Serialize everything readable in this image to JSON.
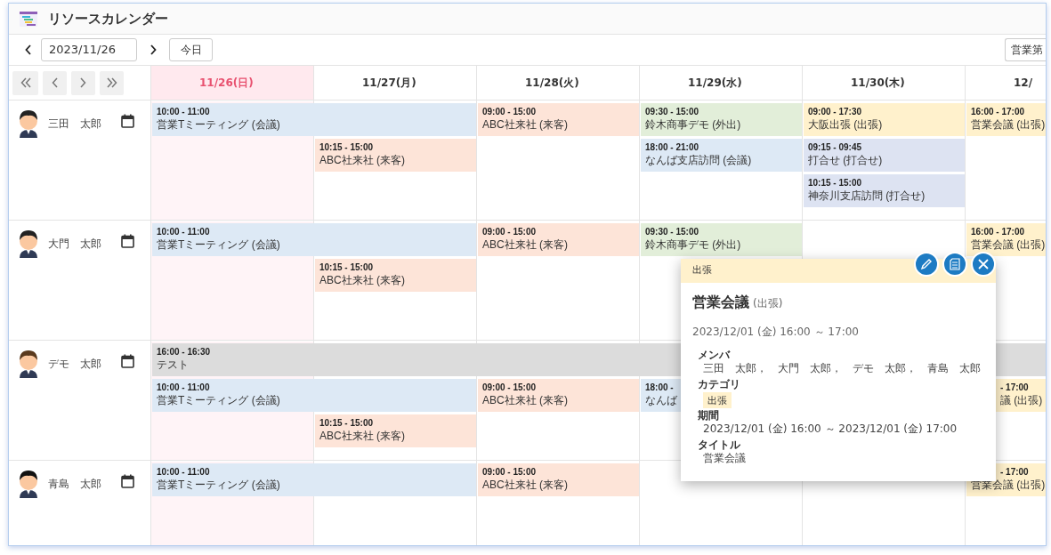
{
  "window": {
    "title": "リソースカレンダー"
  },
  "toolbar": {
    "date": "2023/11/26",
    "today_button": "今日",
    "group_select": "営業第"
  },
  "days": [
    {
      "label": "11/26(日)",
      "holiday": true
    },
    {
      "label": "11/27(月)",
      "holiday": false
    },
    {
      "label": "11/28(火)",
      "holiday": false
    },
    {
      "label": "11/29(水)",
      "holiday": false
    },
    {
      "label": "11/30(木)",
      "holiday": false
    },
    {
      "label": "12/",
      "holiday": false
    }
  ],
  "people": [
    {
      "name": "三田　太郎",
      "lanes": [
        [
          {
            "kind": "event",
            "time": "10:00 - 11:00",
            "title": "営業Tミーティング (会議)",
            "color": "#dde9f5"
          },
          {
            "kind": "continued"
          },
          {
            "kind": "event",
            "time": "09:00 - 15:00",
            "title": "ABC社来社 (来客)",
            "color": "#fde4d8"
          },
          {
            "kind": "event",
            "time": "09:30 - 15:00",
            "title": "鈴木商事デモ (外出)",
            "color": "#e2eed9"
          },
          {
            "kind": "event",
            "time": "09:00 - 17:30",
            "title": "大阪出張 (出張)",
            "color": "#fff1cc"
          },
          {
            "kind": "event",
            "time": "16:00 - 17:00",
            "title": "営業会議 (出張)",
            "color": "#fff1cc"
          }
        ],
        [
          {
            "kind": "empty"
          },
          {
            "kind": "event",
            "time": "10:15 - 15:00",
            "title": "ABC社来社 (来客)",
            "color": "#fde4d8"
          },
          {
            "kind": "empty"
          },
          {
            "kind": "event",
            "time": "18:00 - 21:00",
            "title": "なんば支店訪問 (会議)",
            "color": "#dde9f5"
          },
          {
            "kind": "event",
            "time": "09:15 - 09:45",
            "title": "打合せ (打合せ)",
            "color": "#dde3f2"
          },
          {
            "kind": "empty"
          }
        ],
        [
          {
            "kind": "empty"
          },
          {
            "kind": "empty"
          },
          {
            "kind": "empty"
          },
          {
            "kind": "empty"
          },
          {
            "kind": "event",
            "time": "10:15 - 15:00",
            "title": "神奈川支店訪問 (打合せ)",
            "color": "#dde3f2"
          },
          {
            "kind": "empty"
          }
        ]
      ]
    },
    {
      "name": "大門　太郎",
      "lanes": [
        [
          {
            "kind": "event",
            "time": "10:00 - 11:00",
            "title": "営業Tミーティング (会議)",
            "color": "#dde9f5"
          },
          {
            "kind": "continued"
          },
          {
            "kind": "event",
            "time": "09:00 - 15:00",
            "title": "ABC社来社 (来客)",
            "color": "#fde4d8"
          },
          {
            "kind": "event",
            "time": "09:30 - 15:00",
            "title": "鈴木商事デモ (外出)",
            "color": "#e2eed9"
          },
          {
            "kind": "empty"
          },
          {
            "kind": "event",
            "time": "16:00 - 17:00",
            "title": "営業会議 (出張)",
            "color": "#fff1cc"
          }
        ],
        [
          {
            "kind": "empty"
          },
          {
            "kind": "event",
            "time": "10:15 - 15:00",
            "title": "ABC社来社 (来客)",
            "color": "#fde4d8"
          },
          {
            "kind": "empty"
          },
          {
            "kind": "empty"
          },
          {
            "kind": "empty"
          },
          {
            "kind": "empty"
          }
        ]
      ]
    },
    {
      "name": "デモ　太郎",
      "lanes": [
        [
          {
            "kind": "event",
            "time": "16:00 - 16:30",
            "title": "テスト",
            "color": "#dcdcdc"
          },
          {
            "kind": "continued"
          },
          {
            "kind": "continued"
          },
          {
            "kind": "continued"
          },
          {
            "kind": "continued"
          },
          {
            "kind": "continued"
          }
        ],
        [
          {
            "kind": "event",
            "time": "10:00 - 11:00",
            "title": "営業Tミーティング (会議)",
            "color": "#dde9f5"
          },
          {
            "kind": "continued"
          },
          {
            "kind": "event",
            "time": "09:00 - 15:00",
            "title": "ABC社来社 (来客)",
            "color": "#fde4d8"
          },
          {
            "kind": "event",
            "time": "18:00 -",
            "title": "なんば",
            "color": "#dde9f5"
          },
          {
            "kind": "empty"
          },
          {
            "kind": "covered",
            "time": "- 17:00",
            "title": "議 (出張)",
            "color": "#fff1cc"
          }
        ],
        [
          {
            "kind": "empty"
          },
          {
            "kind": "event",
            "time": "10:15 - 15:00",
            "title": "ABC社来社 (来客)",
            "color": "#fde4d8"
          },
          {
            "kind": "empty"
          },
          {
            "kind": "empty"
          },
          {
            "kind": "empty"
          },
          {
            "kind": "empty"
          }
        ]
      ]
    },
    {
      "name": "青島　太郎",
      "lanes": [
        [
          {
            "kind": "event",
            "time": "10:00 - 11:00",
            "title": "営業Tミーティング (会議)",
            "color": "#dde9f5"
          },
          {
            "kind": "continued"
          },
          {
            "kind": "event",
            "time": "09:00 - 15:00",
            "title": "ABC社来社 (来客)",
            "color": "#fde4d8"
          },
          {
            "kind": "empty"
          },
          {
            "kind": "empty"
          },
          {
            "kind": "covered_top",
            "time": "- 17:00",
            "title": "営業会議 (出張)",
            "color": "#fff1cc"
          }
        ]
      ]
    }
  ],
  "popup": {
    "category": "出張",
    "title": "営業会議",
    "title_note": "(出張)",
    "when": "2023/12/01 (金) 16:00 ～ 17:00",
    "fields": [
      {
        "label": "メンバ",
        "kind": "text",
        "value": "三田　太郎，　大門　太郎，　デモ　太郎，　青島　太郎"
      },
      {
        "label": "カテゴリ",
        "kind": "tag",
        "value": "出張"
      },
      {
        "label": "期間",
        "kind": "text",
        "value": "2023/12/01 (金) 16:00 ～ 2023/12/01 (金) 17:00"
      },
      {
        "label": "タイトル",
        "kind": "text",
        "value": "営業会議"
      }
    ]
  }
}
